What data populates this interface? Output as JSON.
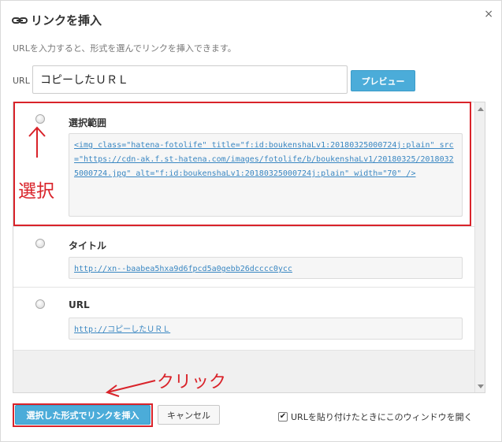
{
  "dialog": {
    "title": "リンクを挿入",
    "description": "URLを入力すると、形式を選んでリンクを挿入できます。",
    "close_label": "×",
    "icons": {
      "link": "link-icon",
      "close": "close-icon"
    }
  },
  "url": {
    "label": "URL",
    "value": "コピーしたＵＲＬ",
    "preview_label": "プレビュー"
  },
  "options": [
    {
      "label": "選択範囲",
      "value": "<img class=\"hatena-fotolife\" title=\"f:id:boukenshaLv1:20180325000724j:plain\" src=\"https://cdn-ak.f.st-hatena.com/images/fotolife/b/boukenshaLv1/20180325/20180325000724.jpg\" alt=\"f:id:boukenshaLv1:20180325000724j:plain\" width=\"70\" />"
    },
    {
      "label": "タイトル",
      "value": "http://xn--baabea5hxa9d6fpcd5a0gebb26dcccc0ycc"
    },
    {
      "label": "URL",
      "value": "http://コピーしたＵＲＬ"
    }
  ],
  "footer": {
    "insert_label": "選択した形式でリンクを挿入",
    "cancel_label": "キャンセル",
    "checkbox_label": "URLを貼り付けたときにこのウィンドウを開く",
    "checkbox_checked": true
  },
  "annotations": {
    "select": "選択",
    "click": "クリック",
    "color": "#d9232a"
  },
  "colors": {
    "accent": "#4bacd9",
    "link": "#3a87c2"
  }
}
